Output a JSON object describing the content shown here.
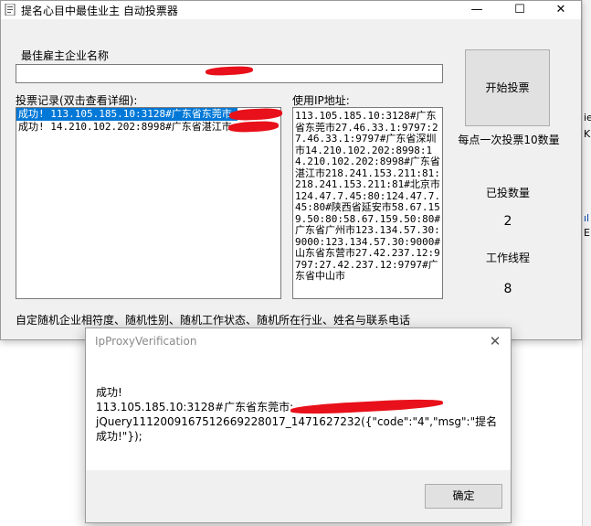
{
  "window": {
    "title": "提名心目中最佳业主  自动投票器",
    "minimize": "—",
    "maximize": "☐",
    "close": "✕"
  },
  "form": {
    "company_label": "最佳雇主企业名称",
    "records_label": "投票记录(双击查看详细):",
    "ip_label": "使用IP地址:",
    "start_button": "开始投票",
    "votes_per_click": "每点一次投票10数量",
    "voted_count_label": "已投数量",
    "voted_count": "2",
    "threads_label": "工作线程",
    "threads": "8",
    "footer_text": "自定随机企业相符度、随机性别、随机工作状态、随机所在行业、姓名与联系电话"
  },
  "records": [
    {
      "text": "成功! 113.105.185.10:3128#广东省东莞市"
    },
    {
      "text": "成功! 14.210.102.202:8998#广东省湛江市"
    }
  ],
  "ip_text": "113.105.185.10:3128#广东省东莞市27.46.33.1:9797:27.46.33.1:9797#广东省深圳市14.210.102.202:8998:14.210.102.202:8998#广东省湛江市218.241.153.211:81:218.241.153.211:81#北京市124.47.7.45:80:124.47.7.45:80#陕西省延安市58.67.159.50:80:58.67.159.50:80#广东省广州市123.134.57.30:9000:123.134.57.30:9000#山东省东营市27.42.237.12:9797:27.42.237.12:9797#广东省中山市",
  "background_window": {
    "line1": "ie(",
    "line2": "K",
    "line3": "ıl",
    "line4": "E"
  },
  "dialog": {
    "title": "IpProxyVerification",
    "close": "✕",
    "line1": "成功!",
    "line2": "113.105.185.10:3128#广东省东莞市:",
    "line3": "jQuery111200916751266922801​7_1471627232({\"code\":\"4\",\"msg\":\"提名成功!\"});",
    "ok_button": "确定"
  },
  "colors": {
    "selection": "#0078d7",
    "redaction": "#e8101a",
    "window_bg": "#f0f0f0"
  }
}
